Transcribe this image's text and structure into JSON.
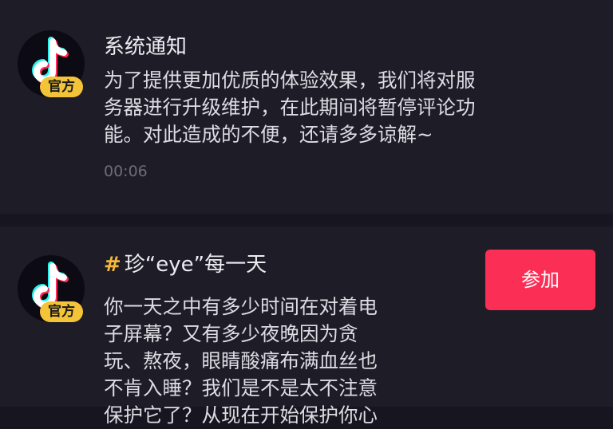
{
  "notifications": [
    {
      "avatar_icon": "tiktok-logo-icon",
      "badge": "官方",
      "title": "系统通知",
      "lines": [
        "为了提供更加优质的体验效果，我们将对服",
        "务器进行升级维护，在此期间将暂停评论功",
        "能。对此造成的不便，还请多多谅解~"
      ],
      "time": "00:06"
    },
    {
      "avatar_icon": "tiktok-logo-icon",
      "badge": "官方",
      "hashtag_symbol": "#",
      "title": "珍“eye”每一天",
      "lines": [
        "你一天之中有多少时间在对着电",
        "子屏幕？又有多少夜晚因为贪",
        "玩、熬夜，眼睛酸痛布满血丝也",
        "不肯入睡？我们是不是太不注意",
        "保护它了？从现在开始保护你心"
      ],
      "action_label": "参加"
    }
  ],
  "colors": {
    "background": "#17151f",
    "card": "#1e1c27",
    "badge": "#f4c438",
    "hashtag": "#f2b93b",
    "button": "#fb2e56",
    "logo_cyan": "#25f4ee",
    "logo_red": "#fe2c55"
  }
}
